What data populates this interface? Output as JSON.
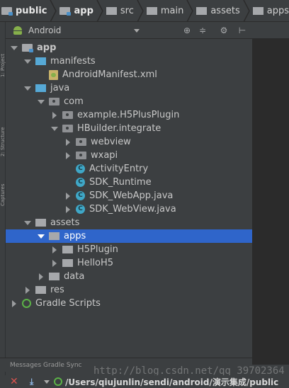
{
  "breadcrumb": {
    "items": [
      {
        "label": "public",
        "icon": "module-folder-icon",
        "bold": true
      },
      {
        "label": "app",
        "icon": "module-folder-icon",
        "bold": true
      },
      {
        "label": "src",
        "icon": "folder-icon",
        "bold": false
      },
      {
        "label": "main",
        "icon": "folder-icon",
        "bold": false
      },
      {
        "label": "assets",
        "icon": "assets-folder-icon",
        "bold": false
      },
      {
        "label": "apps",
        "icon": "folder-icon",
        "bold": false
      }
    ]
  },
  "tool_strip": {
    "tabs": [
      "1: Project",
      "2: Structure",
      "Captures"
    ]
  },
  "panel": {
    "view_label": "Android",
    "icons": [
      "target-icon",
      "collapse-icon",
      "gear-icon",
      "hide-panel-icon"
    ]
  },
  "tree": {
    "selected_color": "#2f65ca",
    "rows": [
      {
        "label": "app",
        "depth": 0,
        "arrow": "down",
        "icon": "module-folder-icon",
        "bold": true
      },
      {
        "label": "manifests",
        "depth": 1,
        "arrow": "down",
        "icon": "folder-blue-icon"
      },
      {
        "label": "AndroidManifest.xml",
        "depth": 2,
        "arrow": "none",
        "icon": "manifest-icon"
      },
      {
        "label": "java",
        "depth": 1,
        "arrow": "down",
        "icon": "folder-blue-icon"
      },
      {
        "label": "com",
        "depth": 2,
        "arrow": "down",
        "icon": "package-icon"
      },
      {
        "label": "example.H5PlusPlugin",
        "depth": 3,
        "arrow": "right",
        "icon": "package-icon"
      },
      {
        "label": "HBuilder.integrate",
        "depth": 3,
        "arrow": "down",
        "icon": "package-icon"
      },
      {
        "label": "webview",
        "depth": 4,
        "arrow": "right",
        "icon": "package-icon"
      },
      {
        "label": "wxapi",
        "depth": 4,
        "arrow": "right",
        "icon": "package-icon"
      },
      {
        "label": "ActivityEntry",
        "depth": 4,
        "arrow": "none",
        "icon": "class-icon"
      },
      {
        "label": "SDK_Runtime",
        "depth": 4,
        "arrow": "none",
        "icon": "class-icon"
      },
      {
        "label": "SDK_WebApp.java",
        "depth": 4,
        "arrow": "right",
        "icon": "class-icon"
      },
      {
        "label": "SDK_WebView.java",
        "depth": 4,
        "arrow": "right",
        "icon": "class-icon"
      },
      {
        "label": "assets",
        "depth": 1,
        "arrow": "down",
        "icon": "folder-gray-icon"
      },
      {
        "label": "apps",
        "depth": 2,
        "arrow": "down",
        "icon": "folder-gray-icon",
        "selected": true
      },
      {
        "label": "H5Plugin",
        "depth": 3,
        "arrow": "right",
        "icon": "folder-gray-icon"
      },
      {
        "label": "HelloH5",
        "depth": 3,
        "arrow": "right",
        "icon": "folder-gray-icon"
      },
      {
        "label": "data",
        "depth": 2,
        "arrow": "right",
        "icon": "folder-gray-icon"
      },
      {
        "label": "res",
        "depth": 1,
        "arrow": "right",
        "icon": "folder-gray-icon"
      },
      {
        "label": "Gradle Scripts",
        "depth": 0,
        "arrow": "right",
        "icon": "gradle-icon"
      }
    ]
  },
  "bottom": {
    "tabs_label": "Messages Gradle Sync",
    "path": "/Users/qiujunlin/sendi/android/演示集成/public",
    "watermark": "http://blog.csdn.net/qq_39702364"
  }
}
